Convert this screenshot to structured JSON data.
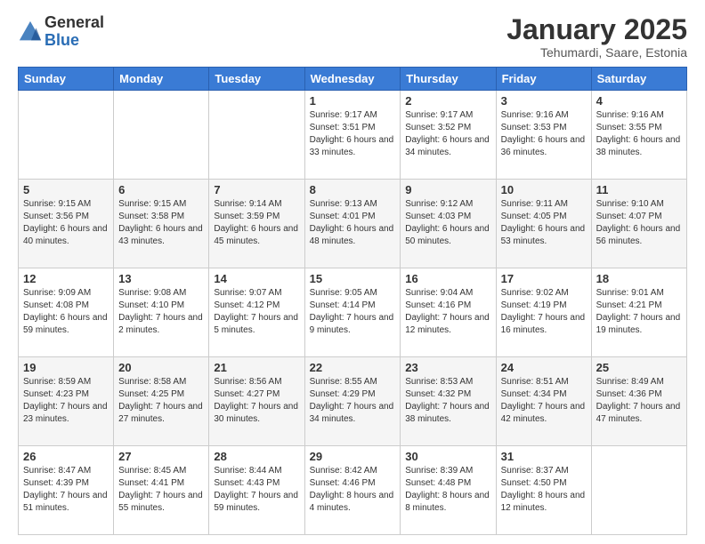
{
  "header": {
    "logo_general": "General",
    "logo_blue": "Blue",
    "month_title": "January 2025",
    "subtitle": "Tehumardi, Saare, Estonia"
  },
  "weekdays": [
    "Sunday",
    "Monday",
    "Tuesday",
    "Wednesday",
    "Thursday",
    "Friday",
    "Saturday"
  ],
  "weeks": [
    [
      {
        "day": "",
        "info": ""
      },
      {
        "day": "",
        "info": ""
      },
      {
        "day": "",
        "info": ""
      },
      {
        "day": "1",
        "info": "Sunrise: 9:17 AM\nSunset: 3:51 PM\nDaylight: 6 hours and 33 minutes."
      },
      {
        "day": "2",
        "info": "Sunrise: 9:17 AM\nSunset: 3:52 PM\nDaylight: 6 hours and 34 minutes."
      },
      {
        "day": "3",
        "info": "Sunrise: 9:16 AM\nSunset: 3:53 PM\nDaylight: 6 hours and 36 minutes."
      },
      {
        "day": "4",
        "info": "Sunrise: 9:16 AM\nSunset: 3:55 PM\nDaylight: 6 hours and 38 minutes."
      }
    ],
    [
      {
        "day": "5",
        "info": "Sunrise: 9:15 AM\nSunset: 3:56 PM\nDaylight: 6 hours and 40 minutes."
      },
      {
        "day": "6",
        "info": "Sunrise: 9:15 AM\nSunset: 3:58 PM\nDaylight: 6 hours and 43 minutes."
      },
      {
        "day": "7",
        "info": "Sunrise: 9:14 AM\nSunset: 3:59 PM\nDaylight: 6 hours and 45 minutes."
      },
      {
        "day": "8",
        "info": "Sunrise: 9:13 AM\nSunset: 4:01 PM\nDaylight: 6 hours and 48 minutes."
      },
      {
        "day": "9",
        "info": "Sunrise: 9:12 AM\nSunset: 4:03 PM\nDaylight: 6 hours and 50 minutes."
      },
      {
        "day": "10",
        "info": "Sunrise: 9:11 AM\nSunset: 4:05 PM\nDaylight: 6 hours and 53 minutes."
      },
      {
        "day": "11",
        "info": "Sunrise: 9:10 AM\nSunset: 4:07 PM\nDaylight: 6 hours and 56 minutes."
      }
    ],
    [
      {
        "day": "12",
        "info": "Sunrise: 9:09 AM\nSunset: 4:08 PM\nDaylight: 6 hours and 59 minutes."
      },
      {
        "day": "13",
        "info": "Sunrise: 9:08 AM\nSunset: 4:10 PM\nDaylight: 7 hours and 2 minutes."
      },
      {
        "day": "14",
        "info": "Sunrise: 9:07 AM\nSunset: 4:12 PM\nDaylight: 7 hours and 5 minutes."
      },
      {
        "day": "15",
        "info": "Sunrise: 9:05 AM\nSunset: 4:14 PM\nDaylight: 7 hours and 9 minutes."
      },
      {
        "day": "16",
        "info": "Sunrise: 9:04 AM\nSunset: 4:16 PM\nDaylight: 7 hours and 12 minutes."
      },
      {
        "day": "17",
        "info": "Sunrise: 9:02 AM\nSunset: 4:19 PM\nDaylight: 7 hours and 16 minutes."
      },
      {
        "day": "18",
        "info": "Sunrise: 9:01 AM\nSunset: 4:21 PM\nDaylight: 7 hours and 19 minutes."
      }
    ],
    [
      {
        "day": "19",
        "info": "Sunrise: 8:59 AM\nSunset: 4:23 PM\nDaylight: 7 hours and 23 minutes."
      },
      {
        "day": "20",
        "info": "Sunrise: 8:58 AM\nSunset: 4:25 PM\nDaylight: 7 hours and 27 minutes."
      },
      {
        "day": "21",
        "info": "Sunrise: 8:56 AM\nSunset: 4:27 PM\nDaylight: 7 hours and 30 minutes."
      },
      {
        "day": "22",
        "info": "Sunrise: 8:55 AM\nSunset: 4:29 PM\nDaylight: 7 hours and 34 minutes."
      },
      {
        "day": "23",
        "info": "Sunrise: 8:53 AM\nSunset: 4:32 PM\nDaylight: 7 hours and 38 minutes."
      },
      {
        "day": "24",
        "info": "Sunrise: 8:51 AM\nSunset: 4:34 PM\nDaylight: 7 hours and 42 minutes."
      },
      {
        "day": "25",
        "info": "Sunrise: 8:49 AM\nSunset: 4:36 PM\nDaylight: 7 hours and 47 minutes."
      }
    ],
    [
      {
        "day": "26",
        "info": "Sunrise: 8:47 AM\nSunset: 4:39 PM\nDaylight: 7 hours and 51 minutes."
      },
      {
        "day": "27",
        "info": "Sunrise: 8:45 AM\nSunset: 4:41 PM\nDaylight: 7 hours and 55 minutes."
      },
      {
        "day": "28",
        "info": "Sunrise: 8:44 AM\nSunset: 4:43 PM\nDaylight: 7 hours and 59 minutes."
      },
      {
        "day": "29",
        "info": "Sunrise: 8:42 AM\nSunset: 4:46 PM\nDaylight: 8 hours and 4 minutes."
      },
      {
        "day": "30",
        "info": "Sunrise: 8:39 AM\nSunset: 4:48 PM\nDaylight: 8 hours and 8 minutes."
      },
      {
        "day": "31",
        "info": "Sunrise: 8:37 AM\nSunset: 4:50 PM\nDaylight: 8 hours and 12 minutes."
      },
      {
        "day": "",
        "info": ""
      }
    ]
  ]
}
